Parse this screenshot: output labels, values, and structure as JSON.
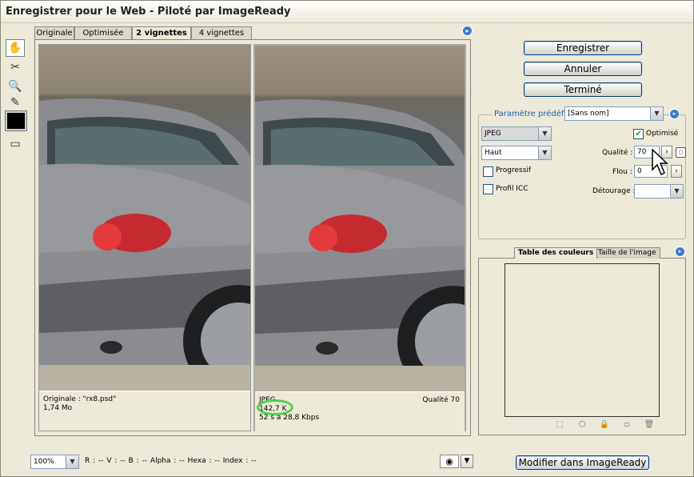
{
  "window": {
    "title": "Enregistrer pour le Web - Piloté par ImageReady"
  },
  "tabs": [
    {
      "label": "Originale"
    },
    {
      "label": "Optimisée"
    },
    {
      "label": "2 vignettes"
    },
    {
      "label": "4 vignettes"
    }
  ],
  "tools": [
    {
      "name": "hand-tool-icon"
    },
    {
      "name": "slice-select-tool-icon"
    },
    {
      "name": "zoom-tool-icon"
    },
    {
      "name": "eyedropper-tool-icon"
    },
    {
      "name": "eyedropper-color-swatch"
    },
    {
      "name": "toggle-slices-icon"
    }
  ],
  "panes": {
    "left": {
      "line1": "Originale : \"rx8.psd\"",
      "line2": "1,74 Mo"
    },
    "right": {
      "line1": "JPEG",
      "line2": "142,7 K",
      "line3": "52 s à 28,8 Kbps",
      "quality": "Qualité 70"
    }
  },
  "buttons": {
    "save": "Enregistrer",
    "cancel": "Annuler",
    "done": "Terminé",
    "edit_in_imageready": "Modifier dans ImageReady"
  },
  "settings": {
    "preset_label": "Paramètre prédéfini :",
    "preset_value": "[Sans nom]",
    "format": "JPEG",
    "quality_level": "Haut",
    "optimized_label": "Optimisé",
    "optimized_checked": true,
    "progressive_label": "Progressif",
    "progressive_checked": false,
    "icc_label": "Profil ICC",
    "icc_checked": false,
    "quality_label": "Qualité :",
    "quality_value": "70",
    "blur_label": "Flou :",
    "blur_value": "0",
    "matte_label": "Détourage :",
    "matte_value": ""
  },
  "color_table": {
    "tab_colors": "Table des couleurs",
    "tab_image_size": "Taille de l'image"
  },
  "status": {
    "zoom": "100%",
    "readout": "R :   --   V :   --   B :   --   Alpha :   --   Hexa :            --   Index :   --"
  },
  "colors": {
    "accent": "#1c5fb5",
    "highlight_circle": "#4ad34a",
    "menu_button": "#3c79c9"
  }
}
